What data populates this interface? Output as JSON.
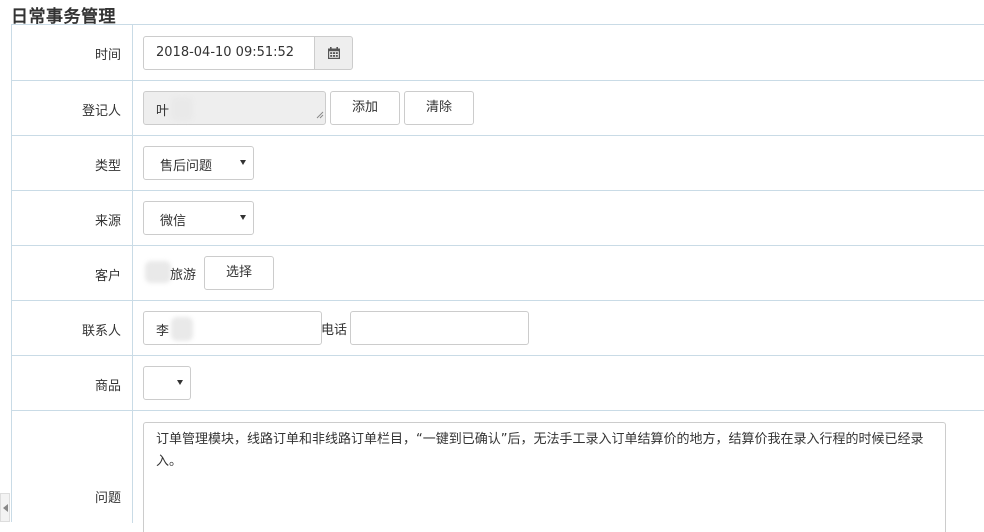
{
  "page": {
    "title": "日常事务管理"
  },
  "form": {
    "time": {
      "label": "时间",
      "value": "2018-04-10 09:51:52",
      "icon": "calendar-icon"
    },
    "registrant": {
      "label": "登记人",
      "value": "叶",
      "add_label": "添加",
      "clear_label": "清除"
    },
    "type": {
      "label": "类型",
      "selected": "售后问题"
    },
    "source": {
      "label": "来源",
      "selected": "微信"
    },
    "customer": {
      "label": "客户",
      "value": "旅游",
      "select_label": "选择"
    },
    "contact": {
      "label": "联系人",
      "value": "李",
      "phone_label": "电话",
      "phone_value": ""
    },
    "product": {
      "label": "商品",
      "selected": ""
    },
    "issue": {
      "label": "问题",
      "value": "订单管理模块，线路订单和非线路订单栏目，“一键到已确认”后，无法手工录入订单结算价的地方，结算价我在录入行程的时候已经录入。"
    }
  },
  "colors": {
    "border": "#c9dbe6",
    "disabled_bg": "#eeeeee",
    "addon_bg": "#eeeeee"
  }
}
